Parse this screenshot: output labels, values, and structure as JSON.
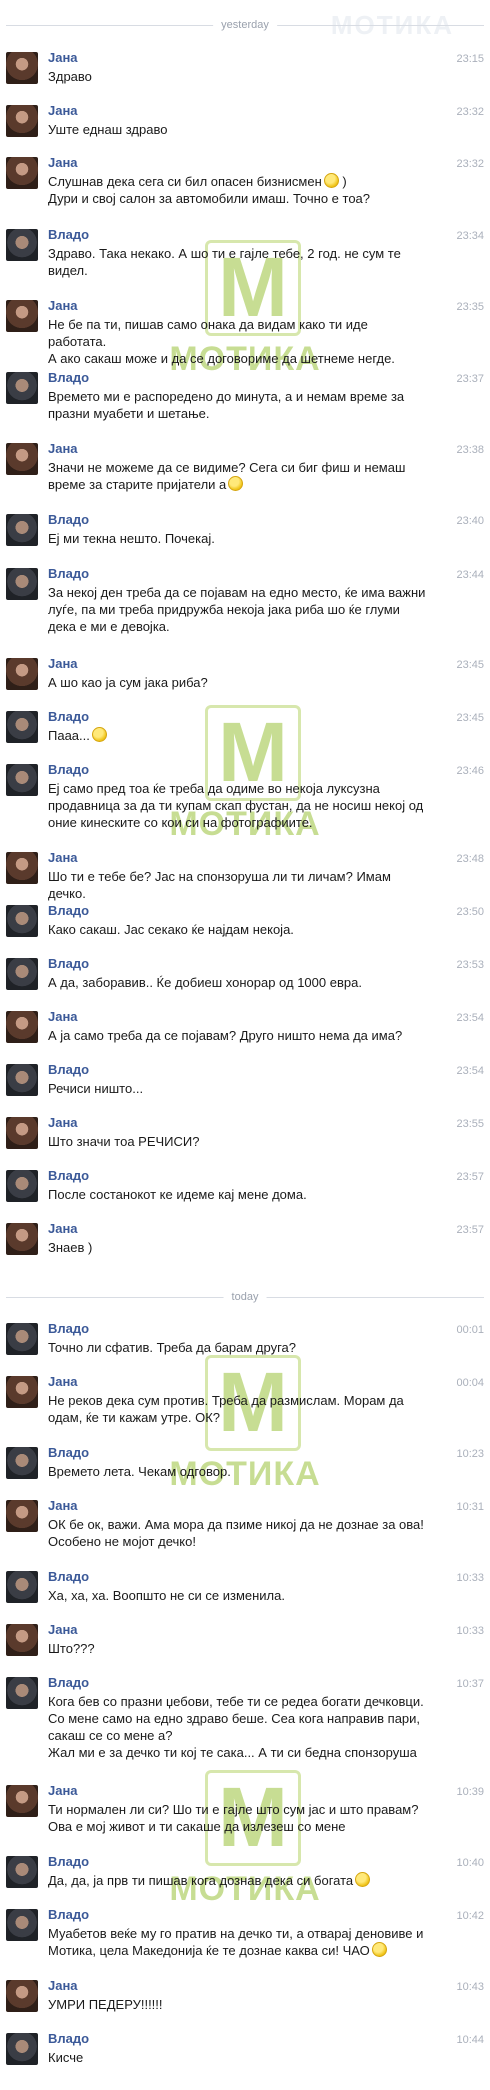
{
  "dividers": [
    "yesterday",
    "today"
  ],
  "watermark_text": "МОТИКА",
  "watermark_letter": "M",
  "top_logo": "МОТИКА",
  "messages": [
    {
      "name": "Јана",
      "time": "23:15",
      "text": "Здраво"
    },
    {
      "name": "Јана",
      "time": "23:32",
      "text": "Уште еднаш здраво"
    },
    {
      "name": "Јана",
      "time": "23:32",
      "text": "Слушнав дека сега си бил опасен бизнисмен",
      "text2": ")",
      "line2": "Дури и свој салон за автомобили имаш. Точно е тоа?"
    },
    {
      "name": "Владо",
      "time": "23:34",
      "text": "Здраво. Така некако. А шо ти е гајле тебе, 2 год. не сум те",
      "line2": "видел."
    },
    {
      "name": "Јана",
      "time": "23:35",
      "text": "Не бе па ти, пишав само онака да видам како ти иде работата.",
      "line2": "А ако сакаш може и да се договориме да шетнеме негде."
    },
    {
      "name": "Владо",
      "time": "23:37",
      "text": "Времето ми е распоредено до минута, а и немам време за",
      "line2": "празни муабети и шетање."
    },
    {
      "name": "Јана",
      "time": "23:38",
      "text": "Значи не можеме да се видиме? Сега си биг фиш и немаш",
      "line2": "време за старите пријатели а"
    },
    {
      "name": "Владо",
      "time": "23:40",
      "text": "Еј ми текна нешто. Почекај."
    },
    {
      "name": "Владо",
      "time": "23:44",
      "text": "За некој ден треба да се појавам на едно место, ќе има важни",
      "line2": "луѓе, па ми треба придружба некоја јака риба шо ќе глуми",
      "line3": "дека е ми е девојка."
    },
    {
      "name": "Јана",
      "time": "23:45",
      "text": "А шо као ја сум јака риба?"
    },
    {
      "name": "Владо",
      "time": "23:45",
      "text": "Пааа..."
    },
    {
      "name": "Владо",
      "time": "23:46",
      "text": "Еј само пред тоа ќе треба да одиме во некоја луксузна",
      "line2": "продавница за да ти купам скап фустан, да не носиш некој од",
      "line3": "оние кинеските со кои си на фотографиите."
    },
    {
      "name": "Јана",
      "time": "23:48",
      "text": "Шо ти е тебе бе? Јас на спонзоруша ли ти личам? Имам дечко."
    },
    {
      "name": "Владо",
      "time": "23:50",
      "text": "Како сакаш. Јас секако ќе најдам некоја."
    },
    {
      "name": "Владо",
      "time": "23:53",
      "text": "А да, заборавив.. Ќе добиеш хонорар од 1000 евра."
    },
    {
      "name": "Јана",
      "time": "23:54",
      "text": "А ја само треба да се појавам? Друго ништо нема да има?"
    },
    {
      "name": "Владо",
      "time": "23:54",
      "text": "Речиси ништо..."
    },
    {
      "name": "Јана",
      "time": "23:55",
      "text": "Што значи тоа РЕЧИСИ?"
    },
    {
      "name": "Владо",
      "time": "23:57",
      "text": "После состанокот ке идеме кај мене дома."
    },
    {
      "name": "Јана",
      "time": "23:57",
      "text": "Знаев )"
    },
    {
      "name": "Владо",
      "time": "00:01",
      "text": "Точно ли сфатив. Треба да барам друга?"
    },
    {
      "name": "Јана",
      "time": "00:04",
      "text": "Не реков дека сум против. Треба да размислам. Морам да",
      "line2": "одам, ќе ти кажам утре. ОК?"
    },
    {
      "name": "Владо",
      "time": "10:23",
      "text": "Времето лета. Чекам одговор."
    },
    {
      "name": "Јана",
      "time": "10:31",
      "text": "ОК бе ок, важи. Ама мора да пзиме никој да не дознае за ова!",
      "line2": "Особено не мојот дечко!"
    },
    {
      "name": "Владо",
      "time": "10:33",
      "text": "Ха, ха, ха. Воопшто не си се изменила."
    },
    {
      "name": "Јана",
      "time": "10:33",
      "text": "Што???"
    },
    {
      "name": "Владо",
      "time": "10:37",
      "text": "Кога бев со празни џебови, тебе ти се редеа богати дечковци.",
      "line2": "Со мене само на едно здраво беше. Сеа кога направив пари,",
      "line3": "сакаш се со мене а?",
      "line4": "Жал ми е за дечко ти кој те сака... А ти си бедна спонзоруша"
    },
    {
      "name": "Јана",
      "time": "10:39",
      "text": "Ти нормален ли си? Шо ти е гајле што сум јас и што правам?",
      "line2": "Ова е мој живот и ти сакаше да излезеш со мене"
    },
    {
      "name": "Владо",
      "time": "10:40",
      "text": "Да, да, ја прв ти пишав кога дознав дека си богата"
    },
    {
      "name": "Владо",
      "time": "10:42",
      "text": "Муабетов веќе му го пратив на дечко ти, а отварај деновиве и",
      "line2": "Мотика, цела Македонија ќе те дознае каква си! ЧАО"
    },
    {
      "name": "Јана",
      "time": "10:43",
      "text": "УМРИ ПЕДЕРУ!!!!!!"
    },
    {
      "name": "Владо",
      "time": "10:44",
      "text": "Кисче"
    }
  ]
}
